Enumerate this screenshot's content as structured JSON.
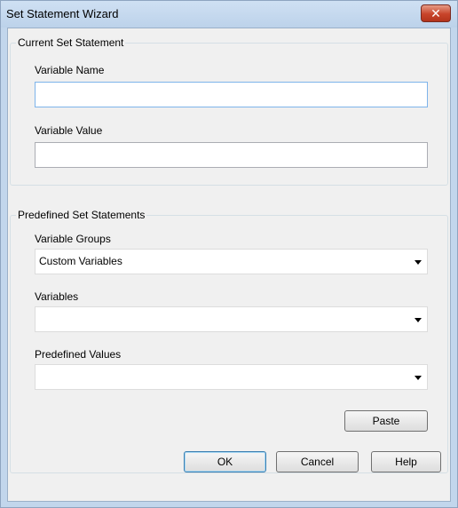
{
  "window": {
    "title": "Set Statement Wizard",
    "close_glyph": "✕"
  },
  "current_group": {
    "title": "Current Set Statement",
    "variable_name_label": "Variable Name",
    "variable_name_value": "",
    "variable_value_label": "Variable Value",
    "variable_value_value": ""
  },
  "predefined_group": {
    "title": "Predefined Set Statements",
    "variable_groups_label": "Variable Groups",
    "variable_groups_selected": "Custom Variables",
    "variables_label": "Variables",
    "variables_selected": "",
    "predefined_values_label": "Predefined Values",
    "predefined_values_selected": "",
    "paste_label": "Paste"
  },
  "footer": {
    "ok_label": "OK",
    "cancel_label": "Cancel",
    "help_label": "Help"
  },
  "colors": {
    "titlebar": "#c2d6ec",
    "dialog_bg": "#f0f0f0",
    "close_button": "#c8442a",
    "focus_border": "#7eb4ea"
  }
}
